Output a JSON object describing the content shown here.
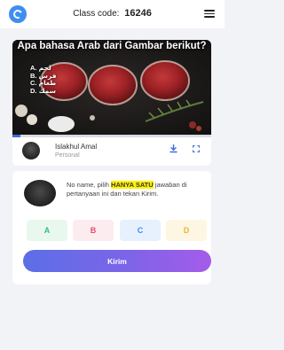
{
  "header": {
    "class_code_label": "Class code:",
    "class_code": "16246",
    "logo_icon": "app-logo-icon",
    "menu_icon": "hamburger-menu-icon"
  },
  "question": {
    "title": "Apa bahasa Arab dari Gambar berikut?",
    "options": [
      {
        "letter": "A.",
        "text": "لحم"
      },
      {
        "letter": "B.",
        "text": "فرس"
      },
      {
        "letter": "C.",
        "text": "طعام"
      },
      {
        "letter": "D.",
        "text": "سمك"
      }
    ],
    "image_description": "raw beef steaks with herbs, garlic and salt",
    "progress_fraction": 0.04
  },
  "author": {
    "name": "Islakhul Amal",
    "role": "Personal",
    "download_icon": "download-icon",
    "fullscreen_icon": "fullscreen-icon"
  },
  "answer": {
    "instruction_before": "No name, pilih ",
    "instruction_highlight": "HANYA SATU",
    "instruction_after": " jawaban di pertanyaan ini dan tekan Kirim.",
    "choices": [
      {
        "label": "A",
        "color": "#2ec27e",
        "bg": "#e9f8ef"
      },
      {
        "label": "B",
        "color": "#e0506b",
        "bg": "#fdecef"
      },
      {
        "label": "C",
        "color": "#3e8ef0",
        "bg": "#e7f1fd"
      },
      {
        "label": "D",
        "color": "#f0b429",
        "bg": "#fdf6e3"
      }
    ],
    "submit_label": "Kirim"
  },
  "colors": {
    "accent": "#3e6de0",
    "background": "#f2f3f7",
    "highlight": "#fff200"
  }
}
